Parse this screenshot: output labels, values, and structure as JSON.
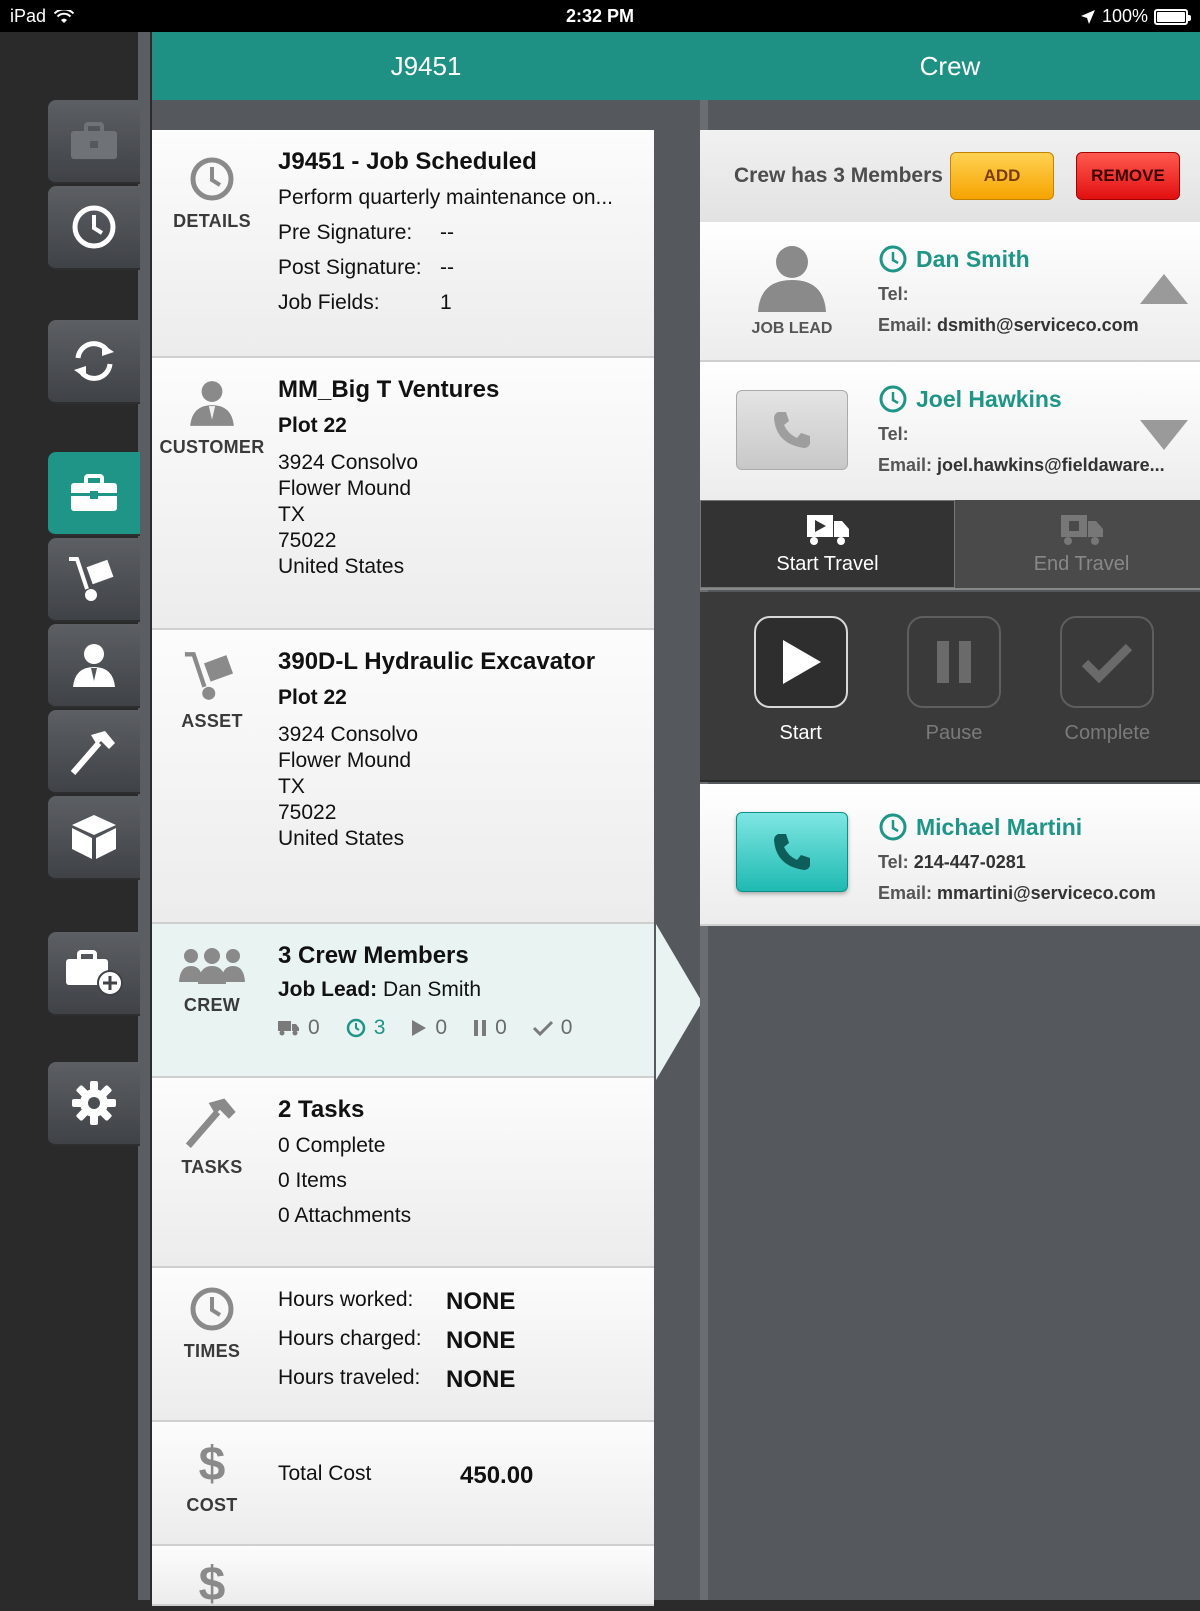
{
  "status_bar": {
    "device": "iPad",
    "time": "2:32 PM",
    "battery": "100%"
  },
  "job_header": {
    "title": "J9451"
  },
  "details": {
    "label": "DETAILS",
    "title": "J9451 - Job Scheduled",
    "description": "Perform quarterly maintenance on...",
    "pre_signature_label": "Pre Signature:",
    "pre_signature_value": "--",
    "post_signature_label": "Post Signature:",
    "post_signature_value": "--",
    "job_fields_label": "Job Fields:",
    "job_fields_value": "1"
  },
  "customer": {
    "label": "CUSTOMER",
    "name": "MM_Big T Ventures",
    "location": "Plot 22",
    "address": [
      "3924 Consolvo",
      "Flower Mound",
      "TX",
      "75022",
      "United States"
    ]
  },
  "asset": {
    "label": "ASSET",
    "name": "390D-L Hydraulic Excavator",
    "location": "Plot 22",
    "address": [
      "3924 Consolvo",
      "Flower Mound",
      "TX",
      "75022",
      "United States"
    ]
  },
  "crew_card": {
    "label": "CREW",
    "title": "3 Crew Members",
    "lead_label": "Job Lead:",
    "lead_name": "Dan Smith",
    "stats": {
      "travel": "0",
      "scheduled": "3",
      "started": "0",
      "paused": "0",
      "complete": "0"
    }
  },
  "tasks": {
    "label": "TASKS",
    "title": "2 Tasks",
    "complete": "0 Complete",
    "items": "0 Items",
    "attachments": "0 Attachments"
  },
  "times": {
    "label": "TIMES",
    "worked_label": "Hours worked:",
    "worked_value": "NONE",
    "charged_label": "Hours charged:",
    "charged_value": "NONE",
    "traveled_label": "Hours traveled:",
    "traveled_value": "NONE"
  },
  "cost": {
    "label": "COST",
    "total_label": "Total Cost",
    "total_value": "450.00"
  },
  "crew_panel": {
    "title": "Crew",
    "count_text": "Crew has 3 Members",
    "add_label": "ADD",
    "remove_label": "REMOVE",
    "members": [
      {
        "name": "Dan Smith",
        "role": "JOB LEAD",
        "tel_label": "Tel:",
        "tel": "",
        "email_label": "Email:",
        "email": "dsmith@serviceco.com"
      },
      {
        "name": "Joel Hawkins",
        "tel_label": "Tel:",
        "tel": "",
        "email_label": "Email:",
        "email": "joel.hawkins@fieldaware..."
      },
      {
        "name": "Michael Martini",
        "tel_label": "Tel:",
        "tel": "214-447-0281",
        "email_label": "Email:",
        "email": "mmartini@serviceco.com"
      }
    ],
    "start_travel_label": "Start Travel",
    "end_travel_label": "End Travel",
    "start_label": "Start",
    "pause_label": "Pause",
    "complete_label": "Complete"
  },
  "colors": {
    "teal": "#1e9587",
    "add": "#f6a400",
    "remove": "#e11010"
  }
}
